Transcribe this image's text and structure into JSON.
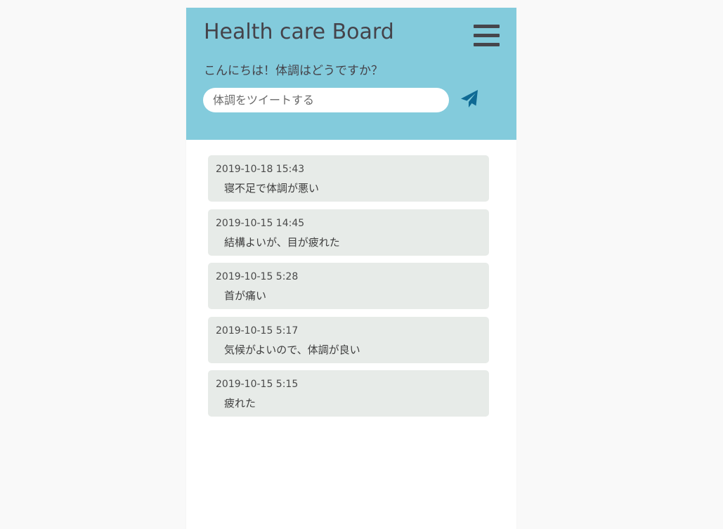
{
  "app": {
    "title": "Health care Board",
    "greeting": "こんにちは！体調はどうですか？",
    "menu_icon": "hamburger-menu-icon",
    "send_icon": "paper-plane-icon"
  },
  "compose": {
    "placeholder": "体調をツイートする",
    "value": ""
  },
  "posts": [
    {
      "time": "2019-10-18 15:43",
      "text": "寝不足で体調が悪い"
    },
    {
      "time": "2019-10-15 14:45",
      "text": "結構よいが、目が疲れた"
    },
    {
      "time": "2019-10-15 5:28",
      "text": "首が痛い"
    },
    {
      "time": "2019-10-15 5:17",
      "text": "気候がよいので、体調が良い"
    },
    {
      "time": "2019-10-15 5:15",
      "text": "疲れた"
    }
  ],
  "colors": {
    "header_bg": "#83cbdc",
    "post_bg": "#e7ebe8",
    "send_icon": "#0f6a94",
    "menu_icon": "#46454b"
  }
}
